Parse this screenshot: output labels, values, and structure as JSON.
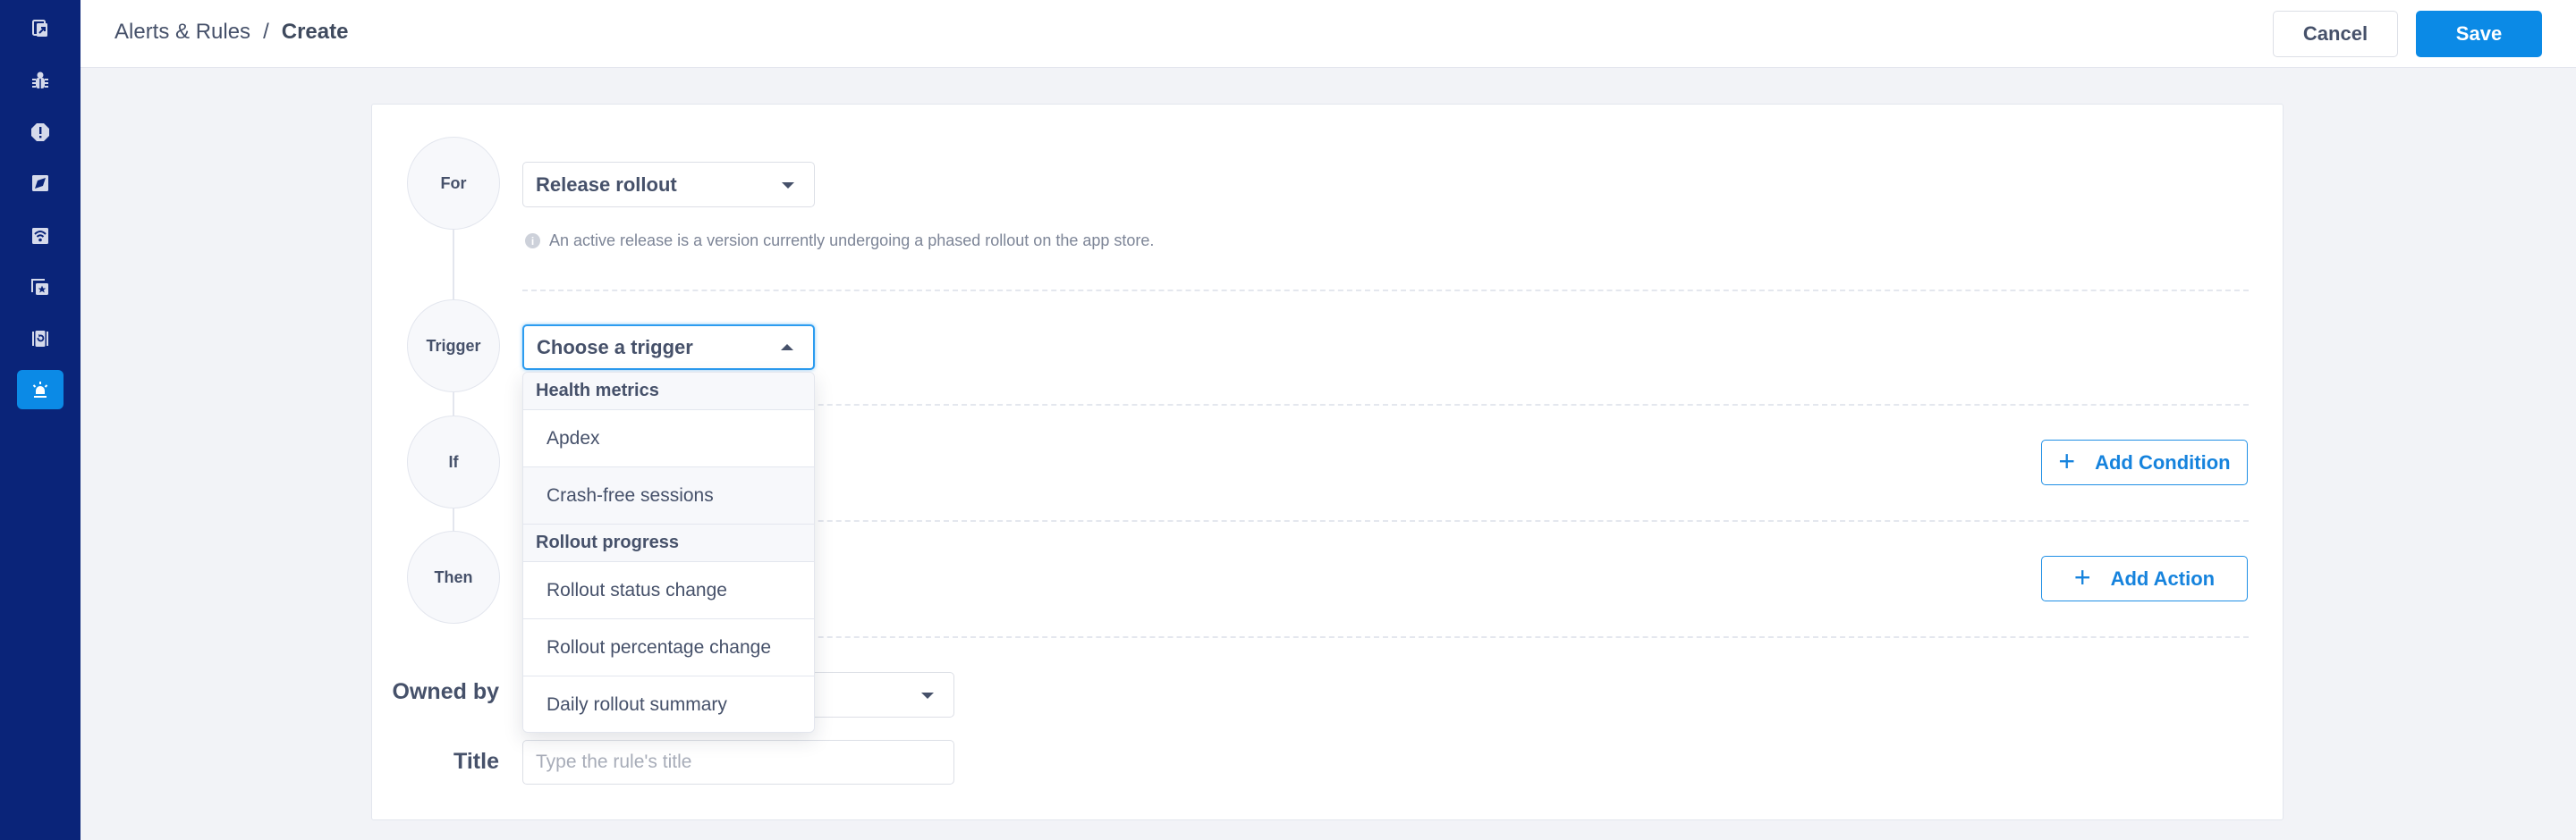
{
  "sidebar": {
    "items": [
      {
        "name": "apps-icon",
        "active": false
      },
      {
        "name": "bug-icon",
        "active": false
      },
      {
        "name": "alert-octagon-icon",
        "active": false
      },
      {
        "name": "rocket-icon",
        "active": false
      },
      {
        "name": "network-icon",
        "active": false
      },
      {
        "name": "starred-icon",
        "active": false
      },
      {
        "name": "session-replay-icon",
        "active": false
      },
      {
        "name": "siren-icon",
        "active": true
      }
    ],
    "colors": {
      "background": "#0a2479",
      "active": "#0b8ae6",
      "icon": "#d5daeb"
    }
  },
  "header": {
    "breadcrumb": {
      "parent": "Alerts & Rules",
      "separator": "/",
      "current": "Create"
    },
    "cancel_label": "Cancel",
    "save_label": "Save",
    "accent": "#0b8ae6"
  },
  "form": {
    "steps": [
      {
        "label": "For"
      },
      {
        "label": "Trigger"
      },
      {
        "label": "If"
      },
      {
        "label": "Then"
      }
    ],
    "for_select": {
      "value": "Release rollout"
    },
    "for_hint": "An active release is a version currently undergoing a phased rollout on the app store.",
    "trigger_select": {
      "placeholder": "Choose a trigger",
      "open": true
    },
    "add_condition_label": "Add Condition",
    "add_action_label": "Add Action",
    "owned_by_label": "Owned by",
    "owned_by_value": "",
    "title_label": "Title",
    "title_placeholder": "Type the rule's title"
  },
  "trigger_dropdown": {
    "groups": [
      {
        "label": "Health metrics",
        "items": [
          "Apdex",
          "Crash-free sessions"
        ]
      },
      {
        "label": "Rollout progress",
        "items": [
          "Rollout status change",
          "Rollout percentage change",
          "Daily rollout summary"
        ]
      }
    ]
  }
}
